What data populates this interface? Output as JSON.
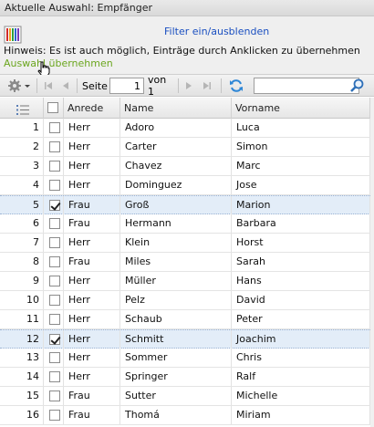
{
  "window": {
    "title": "Aktuelle Auswahl: Empfänger"
  },
  "top": {
    "filter_link": "Filter ein/ausblenden",
    "hint": "Hinweis: Es ist auch möglich, Einträge durch Anklicken zu übernehmen",
    "take_over": "Auswahl übernehmen"
  },
  "toolbar": {
    "page_label": "Seite",
    "page_value": "1",
    "of_label": "von 1",
    "search_value": ""
  },
  "grid": {
    "columns": [
      "",
      "",
      "Anrede",
      "Name",
      "Vorname"
    ],
    "rows": [
      {
        "num": "1",
        "checked": false,
        "anrede": "Herr",
        "name": "Adoro",
        "vorname": "Luca"
      },
      {
        "num": "2",
        "checked": false,
        "anrede": "Herr",
        "name": "Carter",
        "vorname": "Simon"
      },
      {
        "num": "3",
        "checked": false,
        "anrede": "Herr",
        "name": "Chavez",
        "vorname": "Marc"
      },
      {
        "num": "4",
        "checked": false,
        "anrede": "Herr",
        "name": "Dominguez",
        "vorname": "Jose"
      },
      {
        "num": "5",
        "checked": true,
        "anrede": "Frau",
        "name": "Groß",
        "vorname": "Marion"
      },
      {
        "num": "6",
        "checked": false,
        "anrede": "Frau",
        "name": "Hermann",
        "vorname": "Barbara"
      },
      {
        "num": "7",
        "checked": false,
        "anrede": "Herr",
        "name": "Klein",
        "vorname": "Horst"
      },
      {
        "num": "8",
        "checked": false,
        "anrede": "Frau",
        "name": "Miles",
        "vorname": "Sarah"
      },
      {
        "num": "9",
        "checked": false,
        "anrede": "Herr",
        "name": "Müller",
        "vorname": "Hans"
      },
      {
        "num": "10",
        "checked": false,
        "anrede": "Herr",
        "name": "Pelz",
        "vorname": "David"
      },
      {
        "num": "11",
        "checked": false,
        "anrede": "Herr",
        "name": "Schaub",
        "vorname": "Peter"
      },
      {
        "num": "12",
        "checked": true,
        "anrede": "Herr",
        "name": "Schmitt",
        "vorname": "Joachim"
      },
      {
        "num": "13",
        "checked": false,
        "anrede": "Herr",
        "name": "Sommer",
        "vorname": "Chris"
      },
      {
        "num": "14",
        "checked": false,
        "anrede": "Herr",
        "name": "Springer",
        "vorname": "Ralf"
      },
      {
        "num": "15",
        "checked": false,
        "anrede": "Frau",
        "name": "Sutter",
        "vorname": "Michelle"
      },
      {
        "num": "16",
        "checked": false,
        "anrede": "Frau",
        "name": "Thomá",
        "vorname": "Miriam"
      }
    ]
  },
  "icons": {
    "app": "columns-icon",
    "settings": "gear-icon",
    "first": "first-page-icon",
    "prev": "prev-page-icon",
    "next": "next-page-icon",
    "last": "last-page-icon",
    "refresh": "refresh-icon",
    "search": "search-icon",
    "header_list": "list-icon",
    "cursor": "hand-cursor-icon"
  },
  "colors": {
    "link": "#1a4fc0",
    "take_over": "#6ba61f",
    "selected_row": "#e3edf8"
  }
}
